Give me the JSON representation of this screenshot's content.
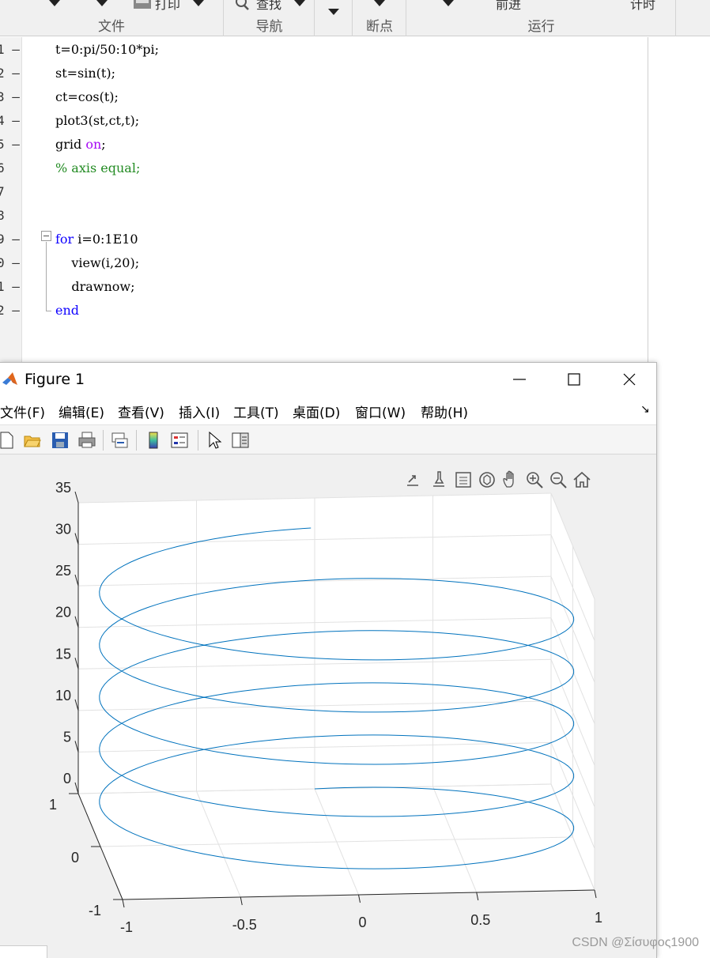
{
  "toolstrip": {
    "sections": [
      {
        "label": "文件"
      },
      {
        "label": "导航"
      },
      {
        "label": ""
      },
      {
        "label": "断点"
      },
      {
        "label": "运行"
      }
    ],
    "print_label": "打印",
    "find_label": "查找",
    "advance_label": "前进",
    "timer_label": "计时"
  },
  "editor": {
    "line_numbers": [
      "1 —",
      "2 —",
      "3 —",
      "4 —",
      "5 —",
      "6",
      "7",
      "8",
      "9 —",
      "0 —",
      "1 —",
      "2 —"
    ],
    "lines": [
      {
        "t": "t=0:pi/50:10*pi;"
      },
      {
        "t": "st=sin(t);"
      },
      {
        "t": "ct=cos(t);"
      },
      {
        "t": "plot3(st,ct,t);"
      },
      {
        "a": "grid ",
        "b": "on",
        "c": ";"
      },
      {
        "cm": "% axis equal;"
      },
      {
        "t": ""
      },
      {
        "t": ""
      },
      {
        "kw": "for",
        "rest": " i=0:1E10"
      },
      {
        "t": "    view(i,20);"
      },
      {
        "t": "    drawnow;"
      },
      {
        "kw": "end",
        "rest": ""
      }
    ]
  },
  "figure": {
    "title": "Figure 1",
    "menu": [
      "文件(F)",
      "编辑(E)",
      "查看(V)",
      "插入(I)",
      "工具(T)",
      "桌面(D)",
      "窗口(W)",
      "帮助(H)"
    ],
    "dock_arrow": "↘",
    "toolbar_icons": [
      "new-figure-icon",
      "open-file-icon",
      "save-icon",
      "print-icon",
      "link-plot-icon",
      "colorbar-icon",
      "legend-icon",
      "edit-plot-pointer-icon",
      "property-inspector-icon"
    ],
    "axes_toolbar_icons": [
      "export-icon",
      "brush-icon",
      "data-tips-icon",
      "rotate-3d-icon",
      "pan-icon",
      "zoom-in-icon",
      "zoom-out-icon",
      "restore-view-icon"
    ]
  },
  "chart_data": {
    "type": "line",
    "title": "",
    "xlabel": "",
    "ylabel": "",
    "zlabel": "",
    "grid": true,
    "view": {
      "azimuth_deg": 0,
      "elevation_deg": 20
    },
    "series": [
      {
        "expression": "x=sin(t), y=cos(t), z=t",
        "t_range": [
          0,
          31.4159
        ],
        "t_step": 0.0628,
        "color": "#0072bd"
      }
    ],
    "xlim": [
      -1,
      1
    ],
    "ylim": [
      -1,
      1
    ],
    "zlim": [
      0,
      35
    ],
    "x_ticks": [
      "-1",
      "-0.5",
      "0",
      "0.5",
      "1"
    ],
    "y_ticks": [
      "-1",
      "0",
      "1"
    ],
    "z_ticks": [
      "0",
      "5",
      "10",
      "15",
      "20",
      "25",
      "30",
      "35"
    ]
  },
  "watermark": "CSDN @Σίσυφος1900"
}
